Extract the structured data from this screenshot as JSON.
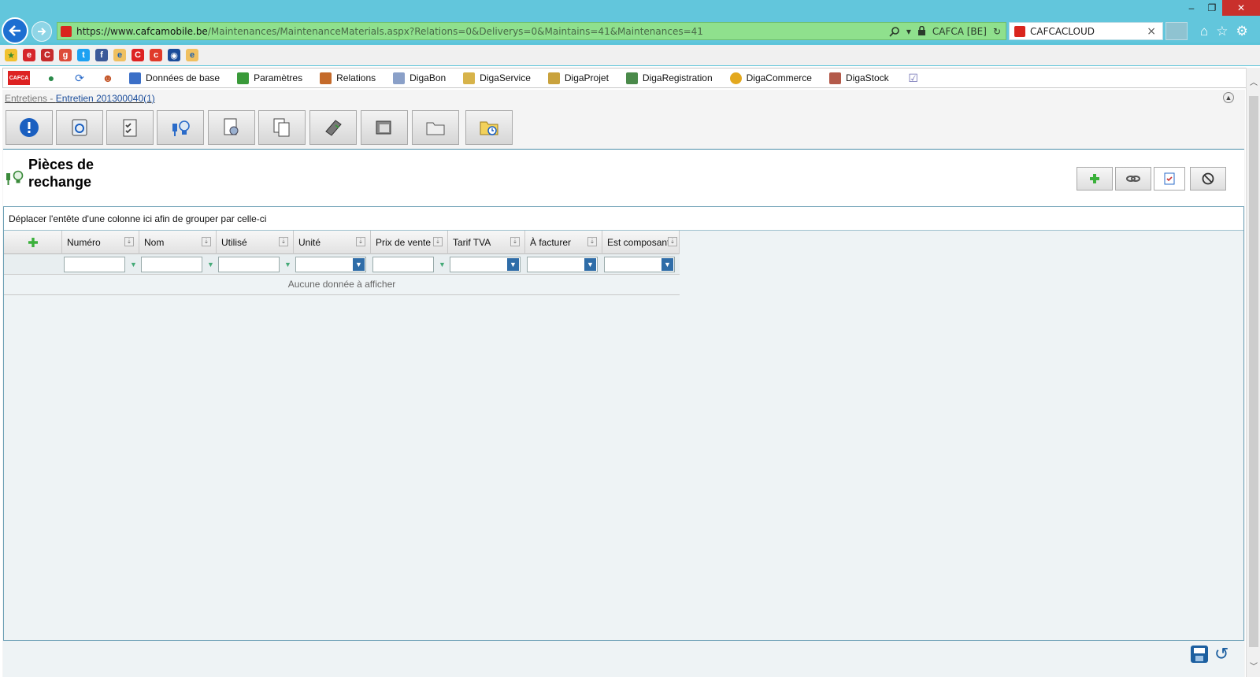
{
  "browser": {
    "url_prefix": "https://www.",
    "url_host": "cafcamobile.be",
    "url_path": "/Maintenances/MaintenanceMaterials.aspx?Relations=0&Deliverys=0&Maintains=41&Maintenances=41",
    "site_identity": "CAFCA [BE]",
    "tab_title": "CAFCACLOUD",
    "tab_close": "×",
    "min_glyph": "–",
    "max_glyph": "❐",
    "close_glyph": "✕"
  },
  "app_menu": {
    "logo_text": "CAFCA",
    "items": [
      {
        "label": "Données de base",
        "color": "#3b6fc7"
      },
      {
        "label": "Paramètres",
        "color": "#3a9a3a"
      },
      {
        "label": "Relations",
        "color": "#c46a2a"
      },
      {
        "label": "DigaBon",
        "color": "#8aa0c8"
      },
      {
        "label": "DigaService",
        "color": "#d7b34a"
      },
      {
        "label": "DigaProjet",
        "color": "#c9a23d"
      },
      {
        "label": "DigaRegistration",
        "color": "#4a8a4a"
      },
      {
        "label": "DigaCommerce",
        "color": "#e3a81e"
      },
      {
        "label": "DigaStock",
        "color": "#b35a4a"
      }
    ]
  },
  "breadcrumb": {
    "root": "Entretiens",
    "separator": " - ",
    "current": "Entretien 201300040(1)"
  },
  "section": {
    "title": "Pièces de rechange"
  },
  "grid": {
    "group_hint": "Déplacer l'entête d'une colonne ici afin de grouper par celle-ci",
    "columns": [
      "Numéro",
      "Nom",
      "Utilisé",
      "Unité",
      "Prix de vente",
      "Tarif TVA",
      "À facturer",
      "Est composant"
    ],
    "empty_text": "Aucune donnée à afficher"
  },
  "colors": {
    "window_frame": "#62c6dc",
    "address_bar": "#8fe08d",
    "accent_blue": "#2f6da8",
    "brand_red": "#d22222"
  }
}
